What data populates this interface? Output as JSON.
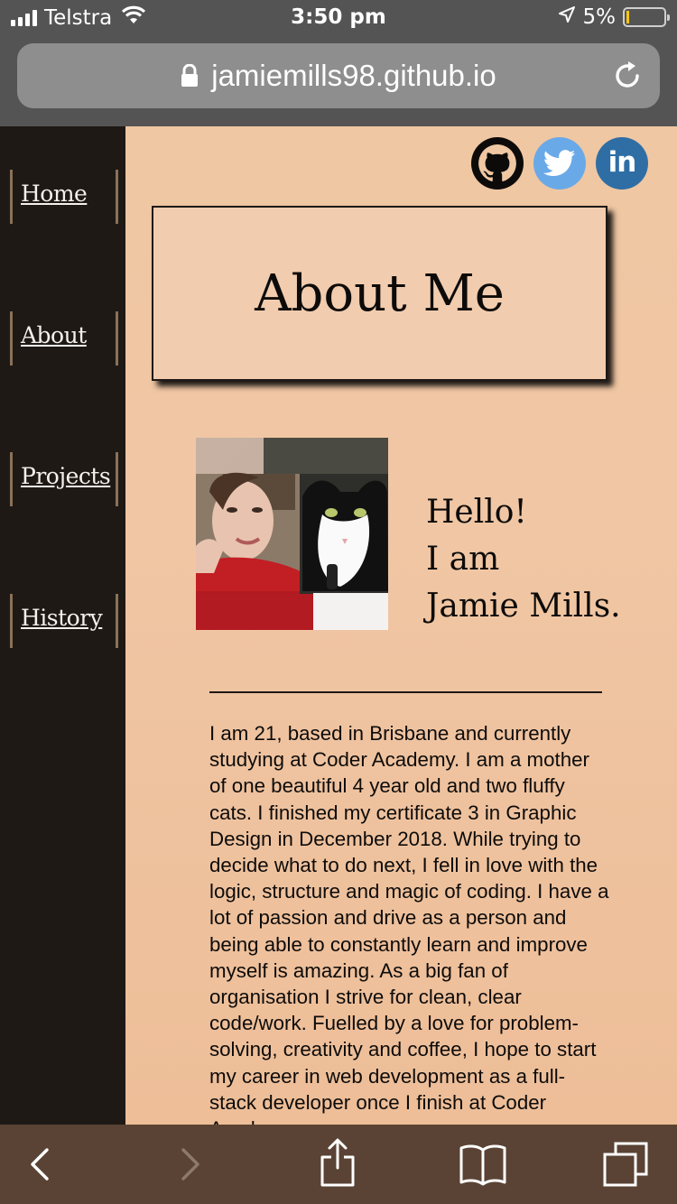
{
  "status_bar": {
    "carrier": "Telstra",
    "time": "3:50 pm",
    "battery": "5%"
  },
  "browser": {
    "url": "jamiemills98.github.io"
  },
  "sidebar": {
    "items": [
      {
        "label": "Home"
      },
      {
        "label": "About"
      },
      {
        "label": "Projects"
      },
      {
        "label": "History"
      }
    ]
  },
  "social": {
    "icons": [
      "github-icon",
      "twitter-icon",
      "linkedin-icon"
    ],
    "linkedin_text": "in"
  },
  "colors": {
    "sidebar": "#1e1915",
    "main_bg": "#efc7a2",
    "title_box_bg": "#f2ccae",
    "twitter": "#6aa9e8",
    "linkedin": "#2f6ea5",
    "status_bar": "#545454",
    "toolbar": "#5a4334"
  },
  "page": {
    "title": "About Me",
    "greeting": [
      "Hello!",
      "I am",
      "Jamie Mills."
    ],
    "bio": "I am 21, based in Brisbane and currently studying at Coder Academy. I am a mother of one beautiful 4 year old and two fluffy cats. I finished my certificate 3 in Graphic Design in December 2018. While trying to decide what to do next, I fell in love with the logic, structure and magic of coding. I have a lot of passion and drive as a person and being able to constantly learn and improve myself is amazing. As a big fan of organisation I strive for clean, clear code/work. Fuelled by a love for problem-solving, creativity and coffee, I hope to start my career in web development as a full-stack developer once I finish at Coder Academy."
  },
  "toolbar": {
    "icons": [
      "back-icon",
      "forward-icon",
      "share-icon",
      "bookmarks-icon",
      "tabs-icon"
    ]
  }
}
